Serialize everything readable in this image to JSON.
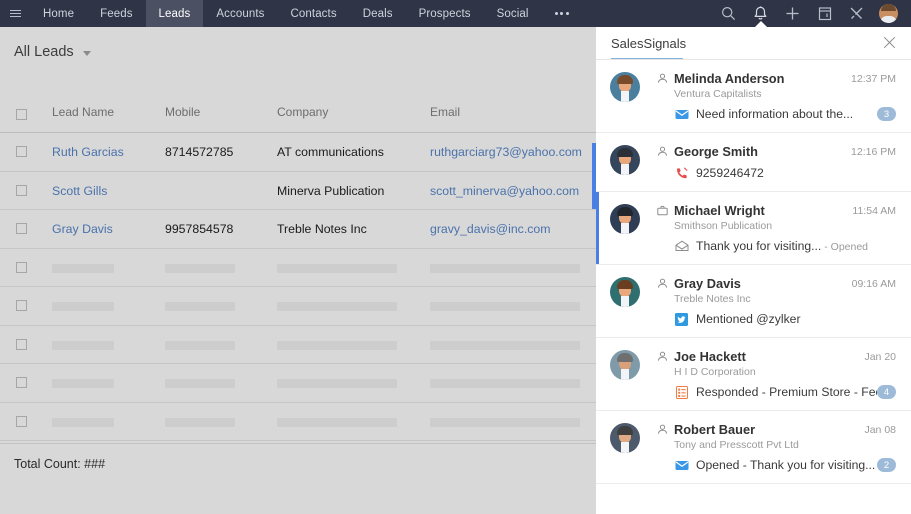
{
  "navbar": {
    "menu_icon": "hamburger-icon",
    "items": [
      {
        "label": "Home",
        "active": false
      },
      {
        "label": "Feeds",
        "active": false
      },
      {
        "label": "Leads",
        "active": true
      },
      {
        "label": "Accounts",
        "active": false
      },
      {
        "label": "Contacts",
        "active": false
      },
      {
        "label": "Deals",
        "active": false
      },
      {
        "label": "Prospects",
        "active": false
      },
      {
        "label": "Social",
        "active": false
      }
    ],
    "more_label": "•••",
    "right_icons": [
      "search-icon",
      "bell-icon",
      "plus-icon",
      "calendar-icon",
      "tools-icon",
      "avatar"
    ],
    "background": "#2f3446",
    "active_background": "#4b5062"
  },
  "list_view": {
    "selector_label": "All Leads",
    "columns": [
      "Lead Name",
      "Mobile",
      "Company",
      "Email"
    ],
    "rows": [
      {
        "name": "Ruth Garcias",
        "mobile": "8714572785",
        "company": "AT communications",
        "email": "ruthgarciarg73@yahoo.com",
        "placeholder": false
      },
      {
        "name": "Scott Gills",
        "mobile": "",
        "company": "Minerva Publication",
        "email": "scott_minerva@yahoo.com",
        "placeholder": false
      },
      {
        "name": "Gray Davis",
        "mobile": "9957854578",
        "company": "Treble Notes Inc",
        "email": "gravy_davis@inc.com",
        "placeholder": false
      },
      {
        "name": "",
        "mobile": "",
        "company": "",
        "email": "",
        "placeholder": true
      },
      {
        "name": "",
        "mobile": "",
        "company": "",
        "email": "",
        "placeholder": true
      },
      {
        "name": "",
        "mobile": "",
        "company": "",
        "email": "",
        "placeholder": true
      },
      {
        "name": "",
        "mobile": "",
        "company": "",
        "email": "",
        "placeholder": true
      },
      {
        "name": "",
        "mobile": "",
        "company": "",
        "email": "",
        "placeholder": true
      },
      {
        "name": "",
        "mobile": "",
        "company": "",
        "email": "",
        "placeholder": true
      }
    ],
    "total_count_label": "Total Count: ###",
    "link_color": "#4a72ab",
    "scrollbar_color": "#4b7fe3"
  },
  "panel": {
    "title": "SalesSignals",
    "close_icon": "close-icon",
    "accent_color": "#84b2e0",
    "badge_color": "#9dbbd8",
    "signals": [
      {
        "name": "Melinda Anderson",
        "record_icon": "lead-person-icon",
        "company": "Ventura Capitalists",
        "time": "12:37 PM",
        "message": "Need information about the...",
        "message_suffix": "",
        "message_icon": "email-icon",
        "badge": "3",
        "selected": false,
        "avatar": {
          "hair": "#7a4b2a",
          "body": "#4a7f9e",
          "skin": "#e8a87c"
        }
      },
      {
        "name": "George Smith",
        "record_icon": "lead-person-icon",
        "company": "",
        "time": "12:16 PM",
        "message": "9259246472",
        "message_suffix": "",
        "message_icon": "missed-call-icon",
        "badge": "",
        "selected": false,
        "avatar": {
          "hair": "#2b3038",
          "body": "#35465c",
          "skin": "#e8a87c"
        }
      },
      {
        "name": "Michael Wright",
        "record_icon": "contact-briefcase-icon",
        "company": "Smithson Publication",
        "time": "11:54 AM",
        "message": "Thank you for visiting...",
        "message_suffix": " - Opened",
        "message_icon": "email-opened-icon",
        "badge": "",
        "selected": true,
        "avatar": {
          "hair": "#22262c",
          "body": "#2f3d55",
          "skin": "#e8a87c"
        }
      },
      {
        "name": "Gray Davis",
        "record_icon": "lead-person-icon",
        "company": "Treble Notes Inc",
        "time": "09:16 AM",
        "message": "Mentioned @zylker",
        "message_suffix": "",
        "message_icon": "twitter-icon",
        "badge": "",
        "selected": false,
        "avatar": {
          "hair": "#6a3e20",
          "body": "#2f6f70",
          "skin": "#e8a87c"
        }
      },
      {
        "name": "Joe Hackett",
        "record_icon": "lead-person-icon",
        "company": "H I D Corporation",
        "time": "Jan 20",
        "message": "Responded - Premium Store - Fee...",
        "message_suffix": "",
        "message_icon": "survey-icon",
        "badge": "4",
        "selected": false,
        "avatar": {
          "hair": "#6f6f6f",
          "body": "#7f9aa8",
          "skin": "#d9a07a"
        }
      },
      {
        "name": "Robert Bauer",
        "record_icon": "lead-person-icon",
        "company": "Tony and Presscott Pvt Ltd",
        "time": "Jan 08",
        "message": "Opened - Thank you for visiting...",
        "message_suffix": "",
        "message_icon": "email-icon",
        "badge": "2",
        "selected": false,
        "avatar": {
          "hair": "#3f3f3f",
          "body": "#4d5a6b",
          "skin": "#e0ab84"
        }
      }
    ]
  }
}
